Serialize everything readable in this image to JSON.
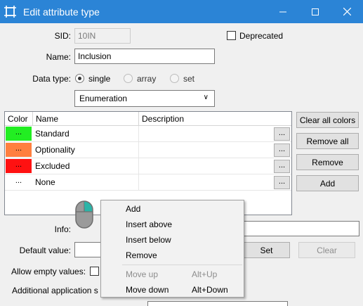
{
  "window": {
    "title": "Edit attribute type",
    "icon": "app-icon",
    "controls": [
      "minimize-icon",
      "maximize-icon",
      "close-icon"
    ]
  },
  "form": {
    "sid_label": "SID:",
    "sid_value": "10IN",
    "deprecated_label": "Deprecated",
    "deprecated_checked": false,
    "name_label": "Name:",
    "name_value": "Inclusion",
    "datatype_label": "Data type:",
    "datatype_options": [
      "single",
      "array",
      "set"
    ],
    "datatype_selected": "single",
    "subtype_value": "Enumeration",
    "info_label": "Info:",
    "default_label": "Default value:",
    "allow_empty_label": "Allow empty values:",
    "additional_label": "Additional application s"
  },
  "grid": {
    "columns": [
      "Color",
      "Name",
      "Description"
    ],
    "rows": [
      {
        "color": "#22ee22",
        "name": "Standard",
        "description": ""
      },
      {
        "color": "#ff7f3f",
        "name": "Optionality",
        "description": ""
      },
      {
        "color": "#ff1111",
        "name": "Excluded",
        "description": ""
      },
      {
        "color": "#ffffff",
        "name": "None",
        "description": ""
      }
    ],
    "swatch_label": "...",
    "desc_button_label": "..."
  },
  "side_buttons": {
    "clear_colors": "Clear all colors",
    "remove_all": "Remove all",
    "remove": "Remove",
    "add": "Add"
  },
  "buttons": {
    "set": "Set",
    "clear": "Clear"
  },
  "context_menu": {
    "items": [
      {
        "label": "Add",
        "shortcut": "",
        "enabled": true
      },
      {
        "label": "Insert above",
        "shortcut": "",
        "enabled": true
      },
      {
        "label": "Insert below",
        "shortcut": "",
        "enabled": true
      },
      {
        "label": "Remove",
        "shortcut": "",
        "enabled": true
      },
      {
        "label": "Move up",
        "shortcut": "Alt+Up",
        "enabled": false
      },
      {
        "label": "Move down",
        "shortcut": "Alt+Down",
        "enabled": true
      }
    ]
  },
  "colors": {
    "titlebar": "#2b84d6",
    "mouse_accent": "#2bb5a8"
  }
}
